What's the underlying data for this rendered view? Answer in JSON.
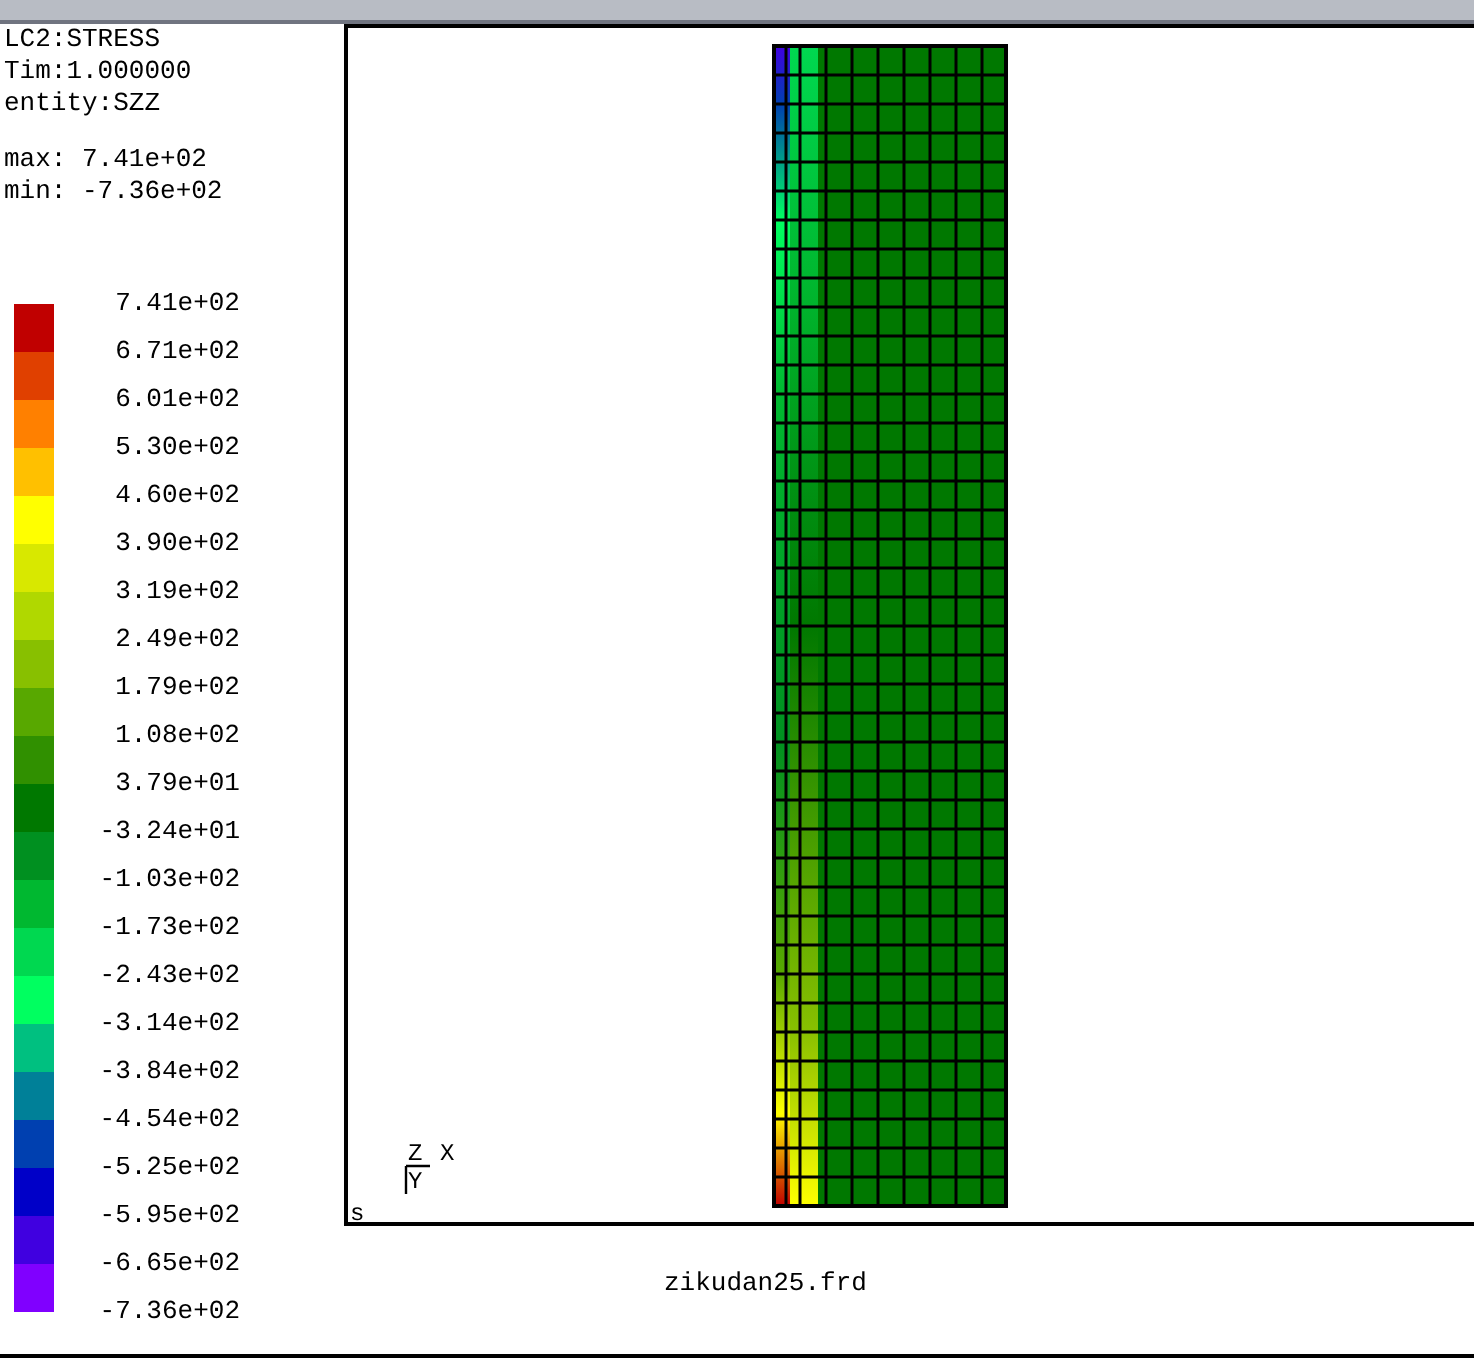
{
  "info": {
    "lines": [
      "LC2:STRESS",
      "Tim:1.000000",
      "entity:SZZ"
    ],
    "max": "max: 7.41e+02",
    "min": "min: -7.36e+02"
  },
  "legend": {
    "labels": [
      "7.41e+02",
      "6.71e+02",
      "6.01e+02",
      "5.30e+02",
      "4.60e+02",
      "3.90e+02",
      "3.19e+02",
      "2.49e+02",
      "1.79e+02",
      "1.08e+02",
      "3.79e+01",
      "-3.24e+01",
      "-1.03e+02",
      "-1.73e+02",
      "-2.43e+02",
      "-3.14e+02",
      "-3.84e+02",
      "-4.54e+02",
      "-5.25e+02",
      "-5.95e+02",
      "-6.65e+02",
      "-7.36e+02"
    ],
    "colors": [
      {
        "color": "#c00000"
      },
      {
        "color": "#e04000"
      },
      {
        "color": "#ff8000"
      },
      {
        "color": "#ffc000"
      },
      {
        "color": "#ffff00"
      },
      {
        "color": "#d8e800"
      },
      {
        "color": "#b0d800"
      },
      {
        "color": "#88c000"
      },
      {
        "color": "#58a800"
      },
      {
        "color": "#309000"
      },
      {
        "color": "#007800"
      },
      {
        "color": "#009020"
      },
      {
        "color": "#00b830"
      },
      {
        "color": "#00d850"
      },
      {
        "color": "#00ff60"
      },
      {
        "color": "#00c080"
      },
      {
        "color": "#008098"
      },
      {
        "color": "#0040b0"
      },
      {
        "color": "#0000c8"
      },
      {
        "color": "#4000e0"
      },
      {
        "color": "#8000ff"
      }
    ]
  },
  "viewport": {
    "axes": {
      "z": "Z",
      "x": "X",
      "y": "Y"
    },
    "corner": "s"
  },
  "filename": "zikudan25.frd"
}
